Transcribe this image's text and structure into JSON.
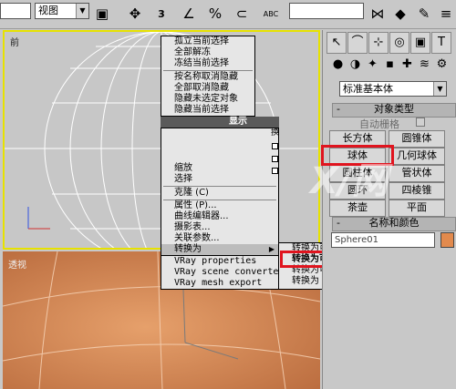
{
  "toolbar": {
    "view_combo": "视图",
    "icons": [
      "select-region-icon",
      "view-dropdown-icon",
      "move-icon",
      "angle-snap-icon",
      "rotate-snap-icon",
      "percent-snap-icon",
      "magnet-icon",
      "abc-named-selection-icon",
      "mirror-icon",
      "align-icon",
      "eraser-icon",
      "edit-icon"
    ],
    "snap_label": "3",
    "percent_label": "%",
    "angle_label": "∠",
    "abc_label": "ABC"
  },
  "viewports": {
    "top_label": "前",
    "bottom_label": "透视"
  },
  "quad_menu": {
    "top_items": [
      "孤立当前选择",
      "全部解冻",
      "冻结当前选择",
      "按名称取消隐藏",
      "全部取消隐藏",
      "隐藏未选定对象",
      "隐藏当前选择"
    ],
    "header": "显示",
    "tool_items": [
      "缩放",
      "选择",
      "克隆 (C)",
      "属性 (P)...",
      "曲线编辑器...",
      "摄影表...",
      "关联参数...",
      "转换为"
    ],
    "highlighted": "转换为",
    "vray_items": [
      "VRay properties",
      "VRay scene converter",
      "VRay mesh export"
    ],
    "transform_label": "换"
  },
  "submenu": {
    "items": [
      "转换为可编辑网格",
      "转换为可编辑多边形",
      "转换为可编辑面片",
      "转换为 NURBS"
    ]
  },
  "panel": {
    "primitive_select": "标准基本体",
    "object_type_header": "对象类型",
    "autogrid_label": "自动栅格",
    "buttons": [
      "长方体",
      "圆锥体",
      "球体",
      "几何球体",
      "圆柱体",
      "管状体",
      "圆环",
      "四棱锥",
      "茶壶",
      "平面"
    ],
    "name_color_header": "名称和颜色",
    "name_value": "Sphere01",
    "swatch_color": "#e28a4d"
  },
  "watermark": "X/网",
  "colors": {
    "highlight_red": "#e0141e",
    "viewport_border": "#e7e200"
  }
}
